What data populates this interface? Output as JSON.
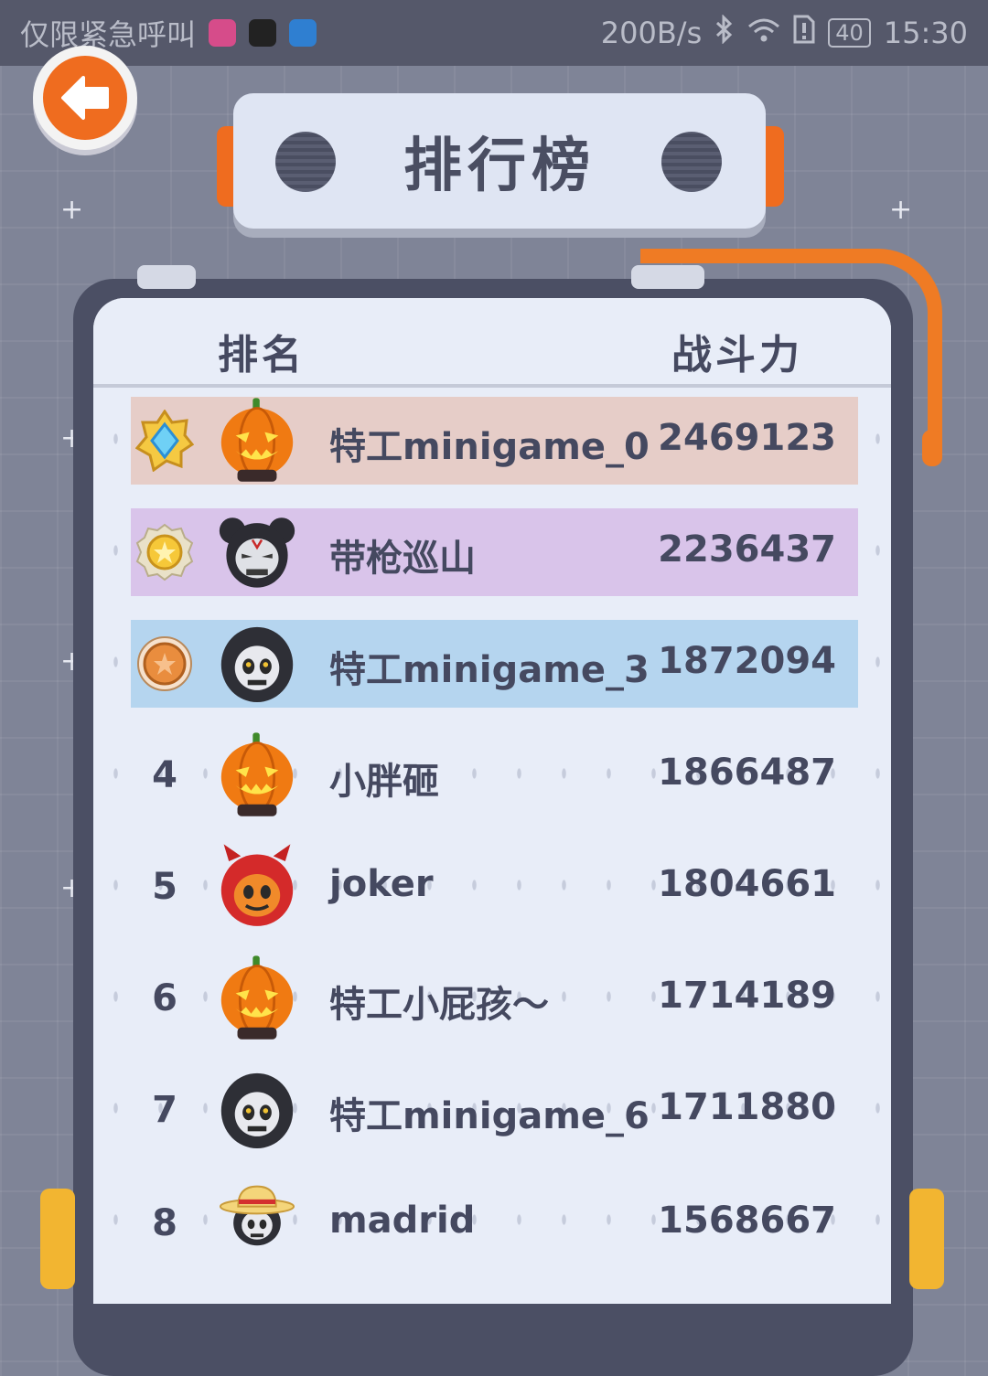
{
  "status_bar": {
    "left_text": "仅限紧急呼叫",
    "net_speed": "200B/s",
    "battery": "40",
    "time": "15:30"
  },
  "title": "排行榜",
  "columns": {
    "rank": "排名",
    "power": "战斗力"
  },
  "rows": [
    {
      "rank": "1",
      "badge": "diamond-medal-icon",
      "avatar": "pumpkin-avatar",
      "name": "特工minigame_0",
      "power": "2469123"
    },
    {
      "rank": "2",
      "badge": "gold-medal-icon",
      "avatar": "mouse-ears-skull-avatar",
      "name": "带枪巡山",
      "power": "2236437"
    },
    {
      "rank": "3",
      "badge": "bronze-medal-icon",
      "avatar": "hooded-skull-avatar",
      "name": "特工minigame_3",
      "power": "1872094"
    },
    {
      "rank": "4",
      "avatar": "pumpkin-avatar",
      "name": "小胖砸",
      "power": "1866487"
    },
    {
      "rank": "5",
      "avatar": "red-devil-avatar",
      "name": "joker",
      "power": "1804661"
    },
    {
      "rank": "6",
      "avatar": "pumpkin-avatar",
      "name": "特工小屁孩～",
      "power": "1714189"
    },
    {
      "rank": "7",
      "avatar": "hooded-skull-avatar",
      "name": "特工minigame_6",
      "power": "1711880"
    },
    {
      "rank": "8",
      "avatar": "straw-hat-skull-avatar",
      "name": "madrid",
      "power": "1568667"
    }
  ]
}
